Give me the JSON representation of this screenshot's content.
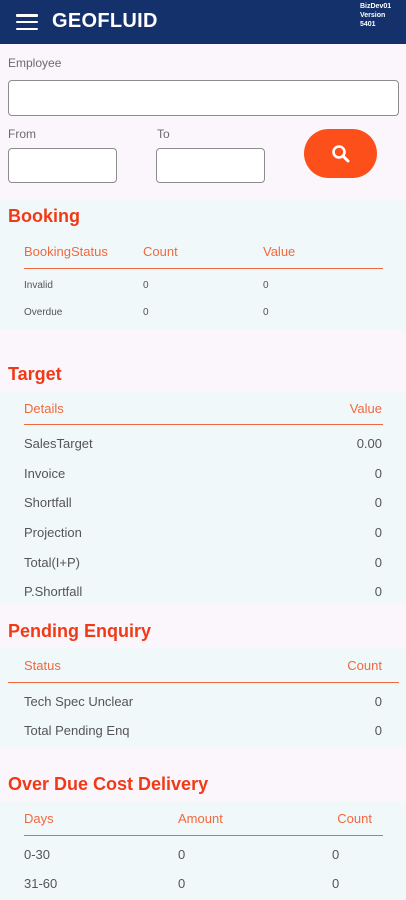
{
  "app": {
    "title": "GEOFLUID",
    "version_lines": [
      "BizDev01",
      "Version",
      "5401"
    ]
  },
  "filters": {
    "employee_label": "Employee",
    "employee_value": "",
    "from_label": "From",
    "from_value": "",
    "to_label": "To",
    "to_value": ""
  },
  "booking": {
    "title": "Booking",
    "headers": [
      "BookingStatus",
      "Count",
      "Value"
    ],
    "rows": [
      [
        "Invalid",
        "0",
        "0"
      ],
      [
        "Overdue",
        "0",
        "0"
      ]
    ]
  },
  "target": {
    "title": "Target",
    "headers": [
      "Details",
      "Value"
    ],
    "rows": [
      [
        "SalesTarget",
        "0.00"
      ],
      [
        "Invoice",
        "0"
      ],
      [
        "Shortfall",
        "0"
      ],
      [
        "Projection",
        "0"
      ],
      [
        "Total(I+P)",
        "0"
      ],
      [
        "P.Shortfall",
        "0"
      ]
    ]
  },
  "pending_enquiry": {
    "title": "Pending Enquiry",
    "headers": [
      "Status",
      "Count"
    ],
    "rows": [
      [
        "Tech Spec Unclear",
        "0"
      ],
      [
        "Total Pending Enq",
        "0"
      ]
    ]
  },
  "over_due": {
    "title": "Over Due Cost Delivery",
    "headers": [
      "Days",
      "Amount",
      "Count"
    ],
    "rows": [
      [
        "0-30",
        "0",
        "0"
      ],
      [
        "31-60",
        "0",
        "0"
      ]
    ]
  },
  "colors": {
    "appbar": "#15316b",
    "accent": "#fd4f1a",
    "section_title": "#f03a17",
    "table_header": "#f2683e"
  }
}
